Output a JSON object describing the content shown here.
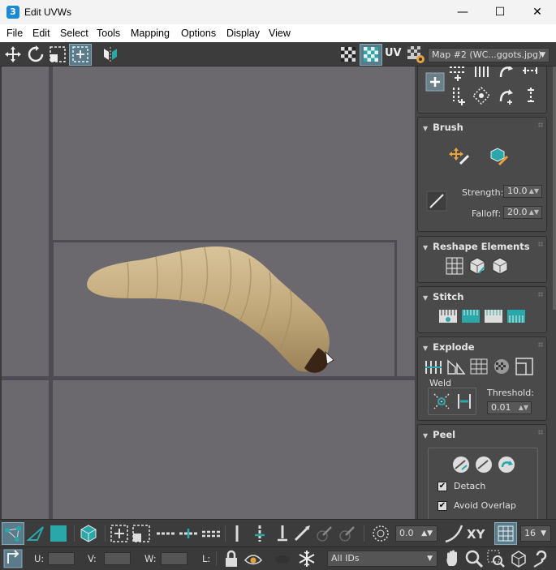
{
  "window": {
    "title": "Edit UVWs",
    "app_icon": "3",
    "minimize": "—",
    "maximize": "☐",
    "close": "✕"
  },
  "menu": [
    "File",
    "Edit",
    "Select",
    "Tools",
    "Mapping",
    "Options",
    "Display",
    "View"
  ],
  "toolbar": {
    "uv_label": "UV",
    "map_select": "Map #2 (WC...ggots.jpg)"
  },
  "brush": {
    "title": "Brush",
    "strength_label": "Strength:",
    "strength_value": "10.0",
    "falloff_label": "Falloff:",
    "falloff_value": "20.0"
  },
  "reshape": {
    "title": "Reshape Elements"
  },
  "stitch": {
    "title": "Stitch"
  },
  "explode": {
    "title": "Explode",
    "weld_label": "Weld",
    "threshold_label": "Threshold:",
    "threshold_value": "0.01"
  },
  "peel": {
    "title": "Peel",
    "detach_label": "Detach",
    "detach_checked": true,
    "avoid_overlap_label": "Avoid Overlap",
    "avoid_overlap_checked": true
  },
  "bottom": {
    "offset_value": "0.0",
    "xy_label": "XY",
    "grid_value": "16",
    "u_label": "U:",
    "v_label": "V:",
    "w_label": "W:",
    "l_label": "L:",
    "ids_select": "All IDs"
  },
  "colors": {
    "accent": "#2aa7a9",
    "viewport_bg": "#6b686e",
    "panel_bg": "#444444"
  }
}
